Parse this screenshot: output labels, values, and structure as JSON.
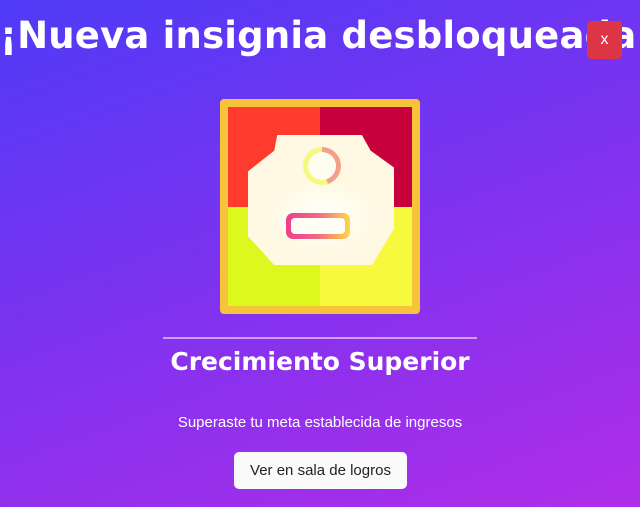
{
  "modal": {
    "title": "¡Nueva insignia desbloqueada!",
    "close_label": "x",
    "badge": {
      "name": "Crecimiento Superior",
      "description": "Superaste tu meta establecida de ingresos",
      "icon": "growth-badge-icon",
      "colors": {
        "frame": "#f6c33a",
        "top_left": "#ff3b2e",
        "top_right": "#c8003c",
        "bottom_left": "#ddf81e",
        "bottom_right": "#f7f93d"
      }
    },
    "view_button_label": "Ver en sala de logros"
  },
  "colors": {
    "close_button": "#dc3545",
    "background_start": "#4f3bf6",
    "background_end": "#b02de8"
  }
}
